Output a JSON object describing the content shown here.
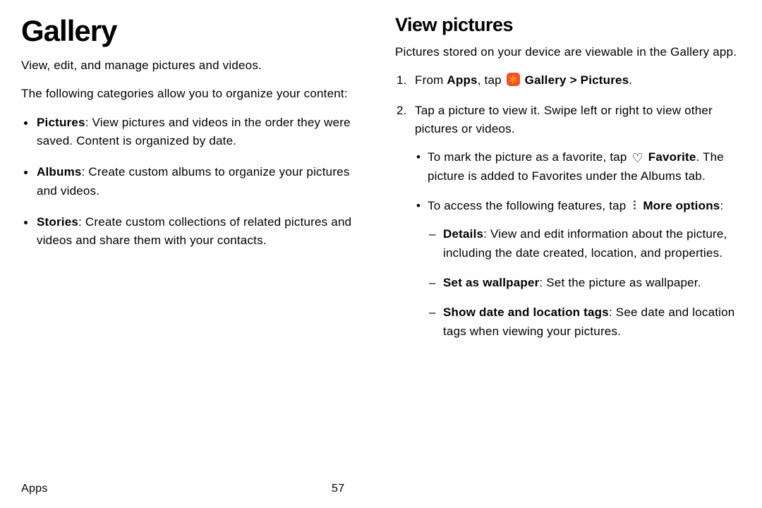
{
  "left": {
    "title": "Gallery",
    "intro": "View, edit, and manage pictures and videos.",
    "lead": "The following categories allow you to organize your content:",
    "categories": [
      {
        "label": "Pictures",
        "desc": ": View pictures and videos in the order they were saved. Content is organized by date."
      },
      {
        "label": "Albums",
        "desc": ": Create custom albums to organize your pictures and videos."
      },
      {
        "label": "Stories",
        "desc": ": Create custom collections of related pictures and videos and share them with your contacts."
      }
    ]
  },
  "right": {
    "title": "View pictures",
    "intro": "Pictures stored on your device are viewable in the Gallery app.",
    "step1": {
      "pre": "From ",
      "apps": "Apps",
      "mid": ", tap ",
      "gallery_pictures": "Gallery > Pictures",
      "post": "."
    },
    "step2": {
      "text": "Tap a picture to view it. Swipe left or right to view other pictures or videos.",
      "sub": [
        {
          "pre": "To mark the picture as a favorite, tap ",
          "label": "Favorite",
          "post": ". The picture is added to Favorites under the Albums tab."
        },
        {
          "pre": "To access the following features, tap ",
          "label": "More options",
          "post": ":"
        }
      ],
      "dash": [
        {
          "label": "Details",
          "desc": ": View and edit information about the picture, including the date created, location, and properties."
        },
        {
          "label": "Set as wallpaper",
          "desc": ": Set the picture as wallpaper."
        },
        {
          "label": "Show date and location tags",
          "desc": ": See date and location tags when viewing your pictures."
        }
      ]
    }
  },
  "footer": {
    "section": "Apps",
    "page": "57"
  }
}
